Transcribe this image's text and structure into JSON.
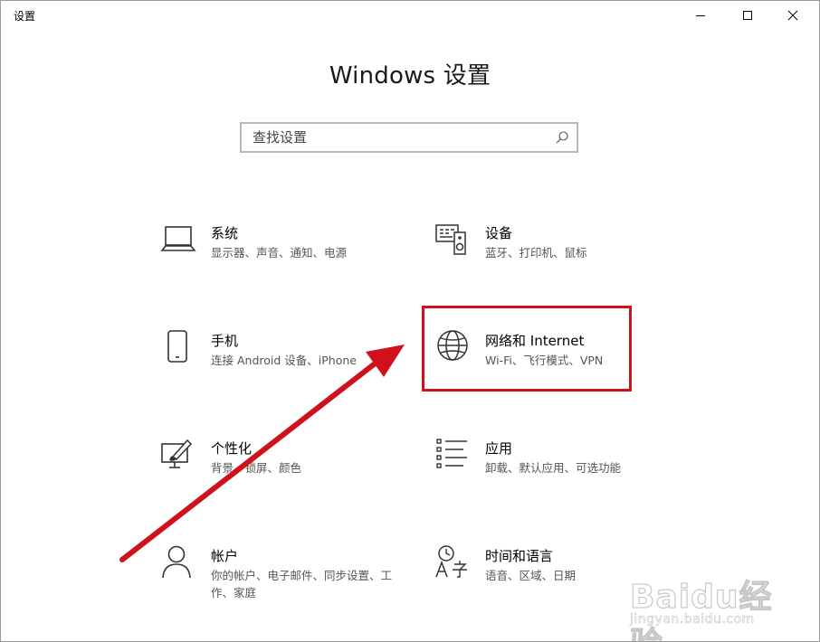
{
  "window": {
    "title": "设置"
  },
  "header": {
    "title": "Windows 设置"
  },
  "search": {
    "placeholder": "查找设置"
  },
  "tiles": [
    {
      "title": "系统",
      "desc": "显示器、声音、通知、电源",
      "icon": "laptop-icon"
    },
    {
      "title": "设备",
      "desc": "蓝牙、打印机、鼠标",
      "icon": "devices-icon"
    },
    {
      "title": "手机",
      "desc": "连接 Android 设备、iPhone",
      "icon": "phone-icon"
    },
    {
      "title": "网络和 Internet",
      "desc": "Wi-Fi、飞行模式、VPN",
      "icon": "globe-icon"
    },
    {
      "title": "个性化",
      "desc": "背景、锁屏、颜色",
      "icon": "personalization-icon"
    },
    {
      "title": "应用",
      "desc": "卸载、默认应用、可选功能",
      "icon": "apps-list-icon"
    },
    {
      "title": "帐户",
      "desc": "你的帐户、电子邮件、同步设置、工作、家庭",
      "icon": "person-icon"
    },
    {
      "title": "时间和语言",
      "desc": "语音、区域、日期",
      "icon": "time-language-icon"
    }
  ],
  "annotation": {
    "highlight_color": "#d0111c"
  },
  "watermark": {
    "brand": "Baidu经验",
    "url": "jingyan.baidu.com"
  }
}
